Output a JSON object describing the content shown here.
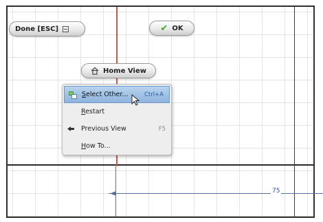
{
  "toolbar": {
    "done_label": "Done [ESC]",
    "ok_label": "OK",
    "home_view_label": "Home View"
  },
  "context_menu": {
    "items": [
      {
        "label": "Select Other...",
        "shortcut": "Ctrl+A",
        "selected": true
      },
      {
        "label": "Restart",
        "shortcut": ""
      },
      {
        "label": "Previous View",
        "shortcut": "F5"
      },
      {
        "label": "How To...",
        "shortcut": ""
      }
    ]
  },
  "dimension": {
    "value": "75"
  },
  "colors": {
    "red_axis": "#e0523f",
    "selection": "#8fb4de",
    "dimension": "#2f4f9a",
    "check": "#3fa52c"
  }
}
